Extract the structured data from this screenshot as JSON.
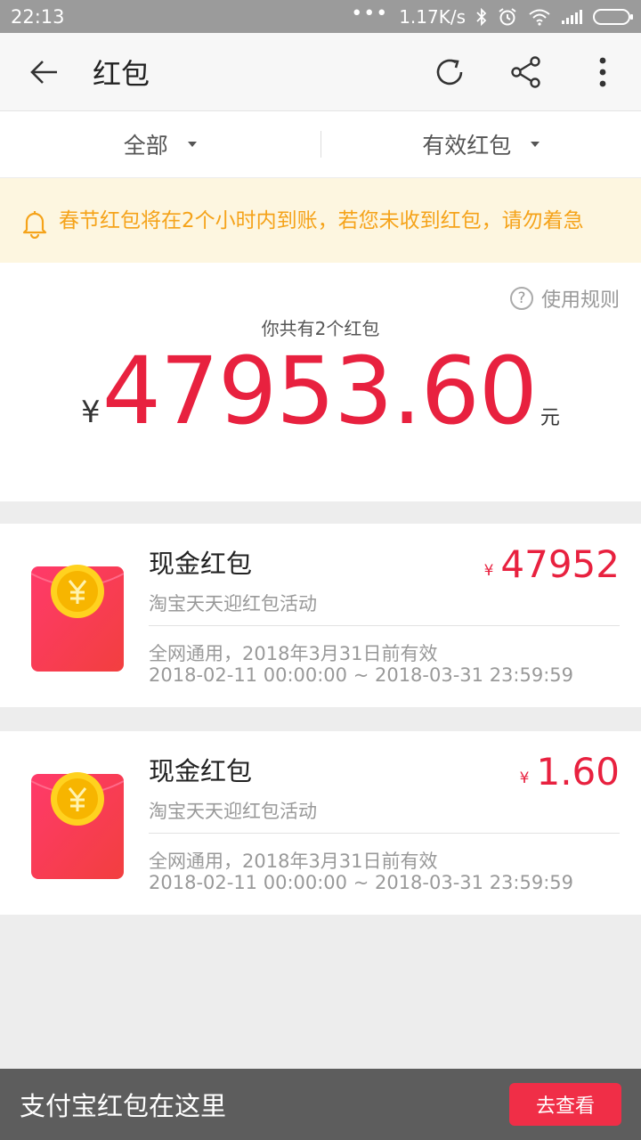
{
  "status_bar": {
    "time": "22:13",
    "network_speed": "1.17K/s",
    "icons": [
      "dots-icon",
      "bluetooth-icon",
      "alarm-icon",
      "wifi-icon",
      "signal-icon",
      "battery-icon"
    ]
  },
  "topbar": {
    "title": "红包",
    "icons": [
      "back-arrow-icon",
      "refresh-icon",
      "share-icon",
      "more-icon"
    ]
  },
  "filters": {
    "all": "全部",
    "valid": "有效红包"
  },
  "notice": {
    "text": "春节红包将在2个小时内到账，若您未收到红包，请勿着急"
  },
  "summary": {
    "rules_link": "使用规则",
    "count_text": "你共有2个红包",
    "currency_symbol": "¥",
    "total": "47953.60",
    "unit": "元"
  },
  "packets": [
    {
      "title": "现金红包",
      "source": "淘宝天天迎红包活动",
      "currency_symbol": "¥",
      "amount": "47952",
      "note": "全网通用，2018年3月31日前有效",
      "range": "2018-02-11 00:00:00 ~ 2018-03-31 23:59:59"
    },
    {
      "title": "现金红包",
      "source": "淘宝天天迎红包活动",
      "currency_symbol": "¥",
      "amount": "1.60",
      "note": "全网通用，2018年3月31日前有效",
      "range": "2018-02-11 00:00:00 ~ 2018-03-31 23:59:59"
    }
  ],
  "bottom_bar": {
    "text": "支付宝红包在这里",
    "button": "去查看"
  },
  "colors": {
    "accent_red": "#e8213f",
    "notice_orange": "#f5a31a",
    "notice_bg": "#fdf6e0",
    "button_red": "#f02e47"
  }
}
